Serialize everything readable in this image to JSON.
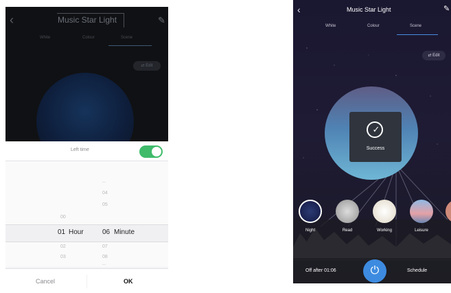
{
  "left_screen": {
    "header": {
      "back_icon": "‹",
      "title": "Music Star Light",
      "edit_icon": "✎"
    },
    "tabs": [
      "White",
      "Colour",
      "Scene"
    ],
    "edit_label": "⇄ Edit",
    "sheet": {
      "left_time_label": "Left time",
      "toggle_on": true,
      "hours": {
        "above2": "",
        "above1": "00",
        "selected": "01",
        "below1": "02",
        "below2": "03",
        "unit": "Hour"
      },
      "minutes": {
        "above3": "---",
        "above2": "04",
        "above1": "05",
        "selected": "06",
        "below1": "07",
        "below2": "08",
        "below3": "---",
        "unit": "Minute"
      },
      "cancel": "Cancel",
      "ok": "OK"
    }
  },
  "right_screen": {
    "header": {
      "back_icon": "‹",
      "title": "Music Star Light",
      "edit_icon": "✎"
    },
    "tabs": [
      "White",
      "Colour",
      "Scene"
    ],
    "edit_label": "⇄ Edit",
    "toast": {
      "icon": "✓",
      "text": "Success"
    },
    "scenes": [
      {
        "label": "Night"
      },
      {
        "label": "Read"
      },
      {
        "label": "Working"
      },
      {
        "label": "Leisure"
      }
    ],
    "bottom": {
      "off_after": "Off after 01:06",
      "power_icon": "⏻",
      "schedule": "Schedule"
    }
  },
  "colors": {
    "toggle": "#3fbb6a",
    "power": "#3d8be0",
    "tab_underline": "#4a8be0"
  }
}
